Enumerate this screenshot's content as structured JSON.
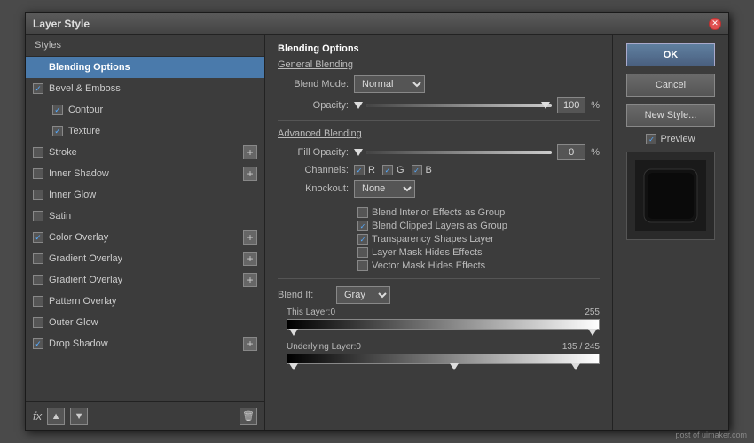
{
  "dialog": {
    "title": "Layer Style",
    "close_label": "✕"
  },
  "left_panel": {
    "styles_label": "Styles",
    "items": [
      {
        "id": "blending-options",
        "label": "Blending Options",
        "has_checkbox": false,
        "checked": false,
        "has_plus": false,
        "selected": true,
        "indent": 0
      },
      {
        "id": "bevel-emboss",
        "label": "Bevel & Emboss",
        "has_checkbox": true,
        "checked": true,
        "has_plus": false,
        "selected": false,
        "indent": 0
      },
      {
        "id": "contour",
        "label": "Contour",
        "has_checkbox": true,
        "checked": true,
        "has_plus": false,
        "selected": false,
        "indent": 1
      },
      {
        "id": "texture",
        "label": "Texture",
        "has_checkbox": true,
        "checked": true,
        "has_plus": false,
        "selected": false,
        "indent": 1
      },
      {
        "id": "stroke",
        "label": "Stroke",
        "has_checkbox": true,
        "checked": false,
        "has_plus": true,
        "selected": false,
        "indent": 0
      },
      {
        "id": "inner-shadow",
        "label": "Inner Shadow",
        "has_checkbox": true,
        "checked": false,
        "has_plus": true,
        "selected": false,
        "indent": 0
      },
      {
        "id": "inner-glow",
        "label": "Inner Glow",
        "has_checkbox": true,
        "checked": false,
        "has_plus": false,
        "selected": false,
        "indent": 0
      },
      {
        "id": "satin",
        "label": "Satin",
        "has_checkbox": true,
        "checked": false,
        "has_plus": false,
        "selected": false,
        "indent": 0
      },
      {
        "id": "color-overlay",
        "label": "Color Overlay",
        "has_checkbox": true,
        "checked": true,
        "has_plus": true,
        "selected": false,
        "indent": 0
      },
      {
        "id": "gradient-overlay-1",
        "label": "Gradient Overlay",
        "has_checkbox": true,
        "checked": false,
        "has_plus": true,
        "selected": false,
        "indent": 0
      },
      {
        "id": "gradient-overlay-2",
        "label": "Gradient Overlay",
        "has_checkbox": true,
        "checked": false,
        "has_plus": true,
        "selected": false,
        "indent": 0
      },
      {
        "id": "pattern-overlay",
        "label": "Pattern Overlay",
        "has_checkbox": true,
        "checked": false,
        "has_plus": false,
        "selected": false,
        "indent": 0
      },
      {
        "id": "outer-glow",
        "label": "Outer Glow",
        "has_checkbox": true,
        "checked": false,
        "has_plus": false,
        "selected": false,
        "indent": 0
      },
      {
        "id": "drop-shadow",
        "label": "Drop Shadow",
        "has_checkbox": true,
        "checked": true,
        "has_plus": true,
        "selected": false,
        "indent": 0
      }
    ]
  },
  "bottom_bar": {
    "fx_label": "fx",
    "up_icon": "▲",
    "down_icon": "▼",
    "trash_icon": "🗑"
  },
  "middle_panel": {
    "section_title": "Blending Options",
    "general_blending_label": "General Blending",
    "blend_mode_label": "Blend Mode:",
    "blend_mode_value": "Normal",
    "opacity_label": "Opacity:",
    "opacity_value": "100",
    "opacity_percent": "%",
    "advanced_blending_label": "Advanced Blending",
    "fill_opacity_label": "Fill Opacity:",
    "fill_opacity_value": "0",
    "fill_percent": "%",
    "channels_label": "Channels:",
    "channel_r": "R",
    "channel_g": "G",
    "channel_b": "B",
    "knockout_label": "Knockout:",
    "knockout_value": "None",
    "blend_interior_label": "Blend Interior Effects as Group",
    "blend_clipped_label": "Blend Clipped Layers as Group",
    "transparency_label": "Transparency Shapes Layer",
    "layer_mask_label": "Layer Mask Hides Effects",
    "vector_mask_label": "Vector Mask Hides Effects",
    "blend_if_label": "Blend If:",
    "blend_if_value": "Gray",
    "this_layer_label": "This Layer:",
    "this_layer_min": "0",
    "this_layer_max": "255",
    "underlying_label": "Underlying Layer:",
    "underlying_min": "0",
    "underlying_mid": "135",
    "underlying_sep": "/",
    "underlying_max": "245"
  },
  "right_panel": {
    "ok_label": "OK",
    "cancel_label": "Cancel",
    "new_style_label": "New Style...",
    "preview_label": "Preview"
  },
  "watermark": "post of uimaker.com"
}
